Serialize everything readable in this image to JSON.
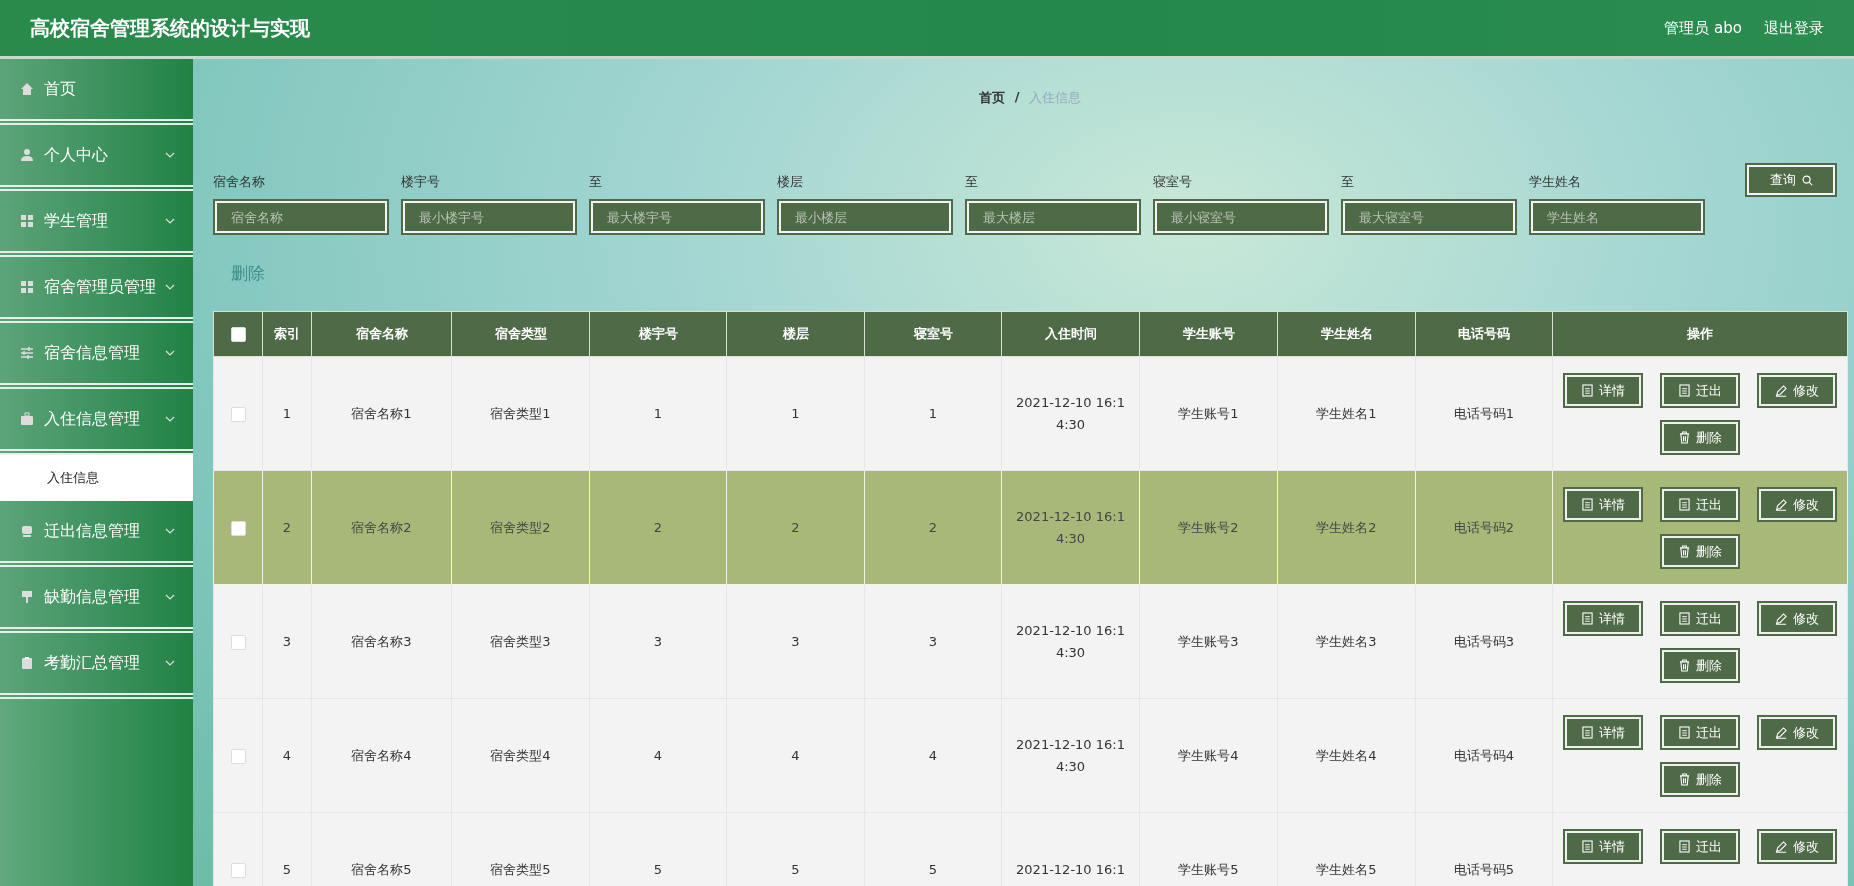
{
  "header": {
    "title": "高校宿舍管理系统的设计与实现",
    "user": "管理员 abo",
    "logout": "退出登录"
  },
  "sidebar": {
    "items": [
      {
        "label": "首页",
        "kind": "link"
      },
      {
        "label": "个人中心",
        "kind": "menu"
      },
      {
        "label": "学生管理",
        "kind": "menu"
      },
      {
        "label": "宿舍管理员管理",
        "kind": "menu"
      },
      {
        "label": "宿舍信息管理",
        "kind": "menu"
      },
      {
        "label": "入住信息管理",
        "kind": "menu",
        "children": [
          {
            "label": "入住信息",
            "selected": true
          }
        ]
      },
      {
        "label": "迁出信息管理",
        "kind": "menu"
      },
      {
        "label": "缺勤信息管理",
        "kind": "menu"
      },
      {
        "label": "考勤汇总管理",
        "kind": "menu"
      }
    ]
  },
  "breadcrumb": {
    "items": [
      "首页",
      "入住信息"
    ],
    "separator": "/"
  },
  "filters": [
    {
      "label": "宿舍名称",
      "placeholder": "宿舍名称"
    },
    {
      "label": "楼宇号",
      "placeholder": "最小楼宇号"
    },
    {
      "label": "至",
      "placeholder": "最大楼宇号"
    },
    {
      "label": "楼层",
      "placeholder": "最小楼层"
    },
    {
      "label": "至",
      "placeholder": "最大楼层"
    },
    {
      "label": "寝室号",
      "placeholder": "最小寝室号"
    },
    {
      "label": "至",
      "placeholder": "最大寝室号"
    },
    {
      "label": "学生姓名",
      "placeholder": "学生姓名"
    }
  ],
  "search_button": "查询",
  "delete_link": "删除",
  "table": {
    "select_all_checked": false,
    "columns": [
      "索引",
      "宿舍名称",
      "宿舍类型",
      "楼宇号",
      "楼层",
      "寝室号",
      "入住时间",
      "学生账号",
      "学生姓名",
      "电话号码",
      "操作"
    ],
    "rows": [
      {
        "selected": false,
        "checked": false,
        "cells": [
          "1",
          "宿舍名称1",
          "宿舍类型1",
          "1",
          "1",
          "1",
          "2021-12-10 16:1 4:30",
          "学生账号1",
          "学生姓名1",
          "电话号码1"
        ],
        "actions": [
          {
            "label": "详情",
            "kind": "doc"
          },
          {
            "label": "迁出",
            "kind": "doc"
          },
          {
            "label": "修改",
            "kind": "edit"
          },
          {
            "label": "删除",
            "kind": "trash"
          }
        ]
      },
      {
        "selected": true,
        "checked": false,
        "cells": [
          "2",
          "宿舍名称2",
          "宿舍类型2",
          "2",
          "2",
          "2",
          "2021-12-10 16:1 4:30",
          "学生账号2",
          "学生姓名2",
          "电话号码2"
        ],
        "actions": [
          {
            "label": "详情",
            "kind": "doc"
          },
          {
            "label": "迁出",
            "kind": "doc"
          },
          {
            "label": "修改",
            "kind": "edit"
          },
          {
            "label": "删除",
            "kind": "trash"
          }
        ]
      },
      {
        "selected": false,
        "checked": false,
        "cells": [
          "3",
          "宿舍名称3",
          "宿舍类型3",
          "3",
          "3",
          "3",
          "2021-12-10 16:1 4:30",
          "学生账号3",
          "学生姓名3",
          "电话号码3"
        ],
        "actions": [
          {
            "label": "详情",
            "kind": "doc"
          },
          {
            "label": "迁出",
            "kind": "doc"
          },
          {
            "label": "修改",
            "kind": "edit"
          },
          {
            "label": "删除",
            "kind": "trash"
          }
        ]
      },
      {
        "selected": false,
        "checked": false,
        "cells": [
          "4",
          "宿舍名称4",
          "宿舍类型4",
          "4",
          "4",
          "4",
          "2021-12-10 16:1 4:30",
          "学生账号4",
          "学生姓名4",
          "电话号码4"
        ],
        "actions": [
          {
            "label": "详情",
            "kind": "doc"
          },
          {
            "label": "迁出",
            "kind": "doc"
          },
          {
            "label": "修改",
            "kind": "edit"
          },
          {
            "label": "删除",
            "kind": "trash"
          }
        ]
      },
      {
        "selected": false,
        "checked": false,
        "cells": [
          "5",
          "宿舍名称5",
          "宿舍类型5",
          "5",
          "5",
          "5",
          "2021-12-10 16:1",
          "学生账号5",
          "学生姓名5",
          "电话号码5"
        ],
        "actions": [
          {
            "label": "详情",
            "kind": "doc"
          },
          {
            "label": "迁出",
            "kind": "doc"
          },
          {
            "label": "修改",
            "kind": "edit"
          }
        ]
      }
    ]
  }
}
